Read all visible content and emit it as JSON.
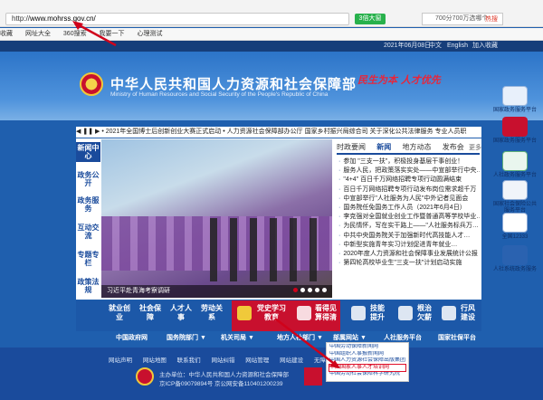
{
  "browser": {
    "url_prefix": "http://",
    "url_host": "www.mohrss.gov.cn/",
    "green_button": "3倍大窗",
    "search_placeholder": "700分700万选哪个",
    "hot_label": "热搜",
    "bookmarks": [
      "收藏",
      "网址大全",
      "360搜索",
      "我要一下",
      "心理测试"
    ]
  },
  "topbar": {
    "date": "2021年06月08日",
    "lang": "中文",
    "en": "English",
    "fav": "加入收藏"
  },
  "header": {
    "title_cn": "中华人民共和国人力资源和社会保障部",
    "title_en": "Ministry of Human Resources and Social Security of the People's Republic of China",
    "slogan": "民生为本  人才优先"
  },
  "notice": {
    "text": "◀ ❚❚ ▶  • 2021年全国博士后创新创业大赛正式启动   • 人力资源社会保障部办公厅 国家乡村振兴局综合司 关于深化公共法律服务 专业人员职"
  },
  "leftnav": [
    "新闻中心",
    "政务公开",
    "政务服务",
    "互动交流",
    "专题专栏",
    "政策法规"
  ],
  "photo": {
    "caption": "习近平赴青海考察调研"
  },
  "tabs": [
    "时政要闻",
    "新闻",
    "地方动态",
    "发布会"
  ],
  "tabs_more": "更多",
  "news": [
    "参加 \"三支一扶\"，积极投身基层干事创业！",
    "服务人民，把政策落实实处——中宣部举行中央…",
    "\"4+4\" 百日千万网络招聘专项行动圆满结束",
    "百日千万网络招聘专项行动发布岗位需求超千万",
    "中宣部举行\"人社服务为人民\"中外记者见面会",
    "国务院任免国务工作人员（2021年6月4日）",
    "李克强对全国就业创业工作暨普通高等学校毕业…",
    "为民情怀，写在实干路上——\"人社服务标兵万…",
    "中共中央国务院关于加强新时代高技能人才…",
    "中新型实施青年实习计划促进青年就业…",
    "2020年度人力资源和社会保障事业发展统计公报",
    "第四轮高校毕业生\"三支一扶\"计划启动实施"
  ],
  "sidebar": [
    "国家政务服务平台",
    "国家政务服务平台",
    "人社政务服务平台",
    "国家社会保险公共服务平台",
    "全国12333",
    "人社系统政务服务"
  ],
  "services": {
    "s1": "就业创业",
    "s2": "社会保障",
    "s3": "人才人事",
    "s4": "劳动关系",
    "s5": "党史学习教育",
    "s6": "看得见 算得清",
    "s7": "技能提升",
    "s8": "根治欠薪",
    "s9": "行风建设"
  },
  "links": [
    "中国政府网",
    "国务院部门 ▼",
    "机关司局 ▼",
    "地方人社部门 ▼",
    "部属网站 ▼",
    "人社服务平台",
    "国家社保平台"
  ],
  "dropdown": [
    "中国劳动保障新闻网",
    "中国组织人事报新闻网",
    "中国人力资源社会保障出版集团",
    "中国国家人事人才培训网",
    "中国劳动社会保障科学研究院"
  ],
  "dropdown_selected_index": 3,
  "footer": {
    "links": [
      "网站声明",
      "网站地图",
      "联系我们",
      "网站纠错",
      "网站管理",
      "网站建设",
      "无障碍"
    ],
    "host": "主办单位：中华人民共和国人力资源和社会保障部",
    "icp": "京ICP备09079894号  京公网安备110401200239"
  }
}
